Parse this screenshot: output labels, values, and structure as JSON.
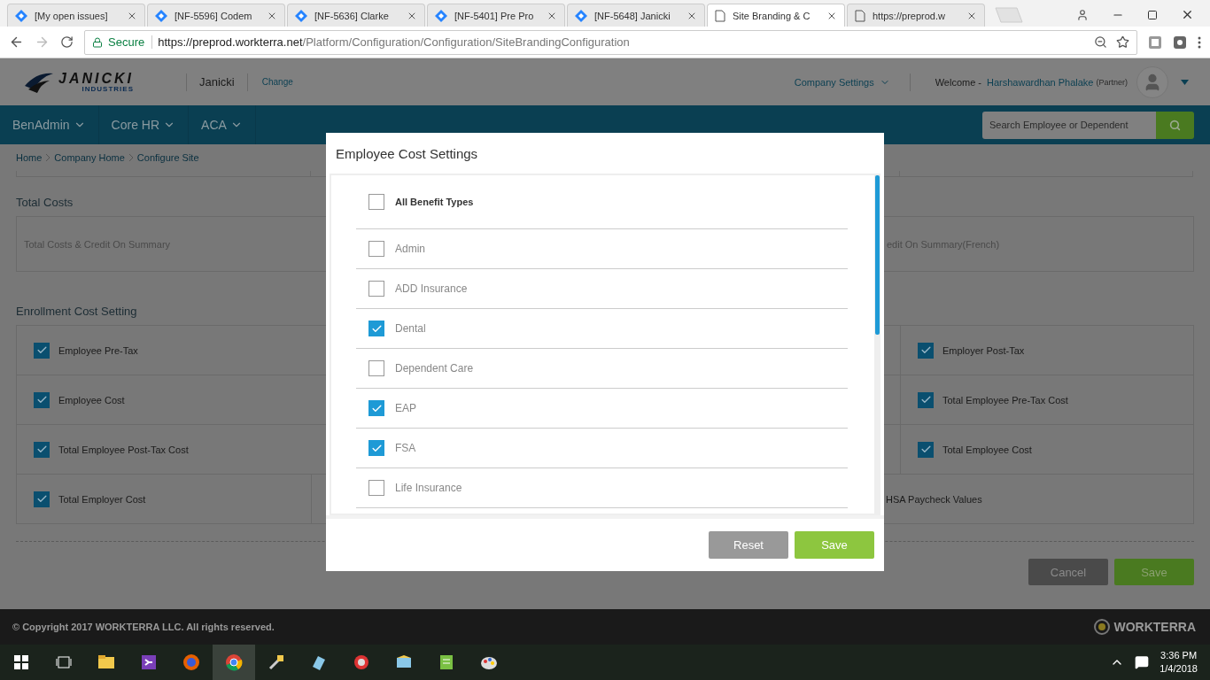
{
  "browser": {
    "tabs": [
      {
        "title": "[My open issues]",
        "kind": "jira",
        "selected": false
      },
      {
        "title": "[NF-5596] Codem",
        "kind": "jira",
        "selected": false
      },
      {
        "title": "[NF-5636] Clarke",
        "kind": "jira",
        "selected": false
      },
      {
        "title": "[NF-5401] Pre Pro",
        "kind": "jira",
        "selected": false
      },
      {
        "title": "[NF-5648] Janicki",
        "kind": "jira",
        "selected": false
      },
      {
        "title": "Site Branding & C",
        "kind": "page",
        "selected": true
      },
      {
        "title": "https://preprod.w",
        "kind": "page",
        "selected": false
      }
    ],
    "address": {
      "secure": "Secure",
      "host": "https://preprod.workterra.net",
      "path": "/Platform/Configuration/Configuration/SiteBrandingConfiguration"
    }
  },
  "header": {
    "logo": {
      "name": "JANICKI",
      "sub": "INDUSTRIES"
    },
    "company": "Janicki",
    "change": "Change",
    "company_settings": "Company Settings",
    "welcome": "Welcome -",
    "user": "Harshawardhan Phalake",
    "role": "(Partner)"
  },
  "nav": {
    "items": [
      "BenAdmin",
      "Core HR",
      "ACA"
    ],
    "search": {
      "placeholder": "Search Employee or Dependent"
    }
  },
  "breadcrumb": [
    "Home",
    "Company Home",
    "Configure Site"
  ],
  "total_costs": {
    "title": "Total Costs",
    "cells": [
      "Total Costs & Credit On Summary",
      "edit On Summary(French)"
    ]
  },
  "enrollment": {
    "title": "Enrollment Cost Setting",
    "rows": [
      {
        "cells": [
          {
            "kind": "checkbox",
            "label": "Employee Pre-Tax",
            "checked": true
          },
          {
            "kind": "checkbox",
            "label": "Employer Post-Tax",
            "checked": true
          }
        ]
      },
      {
        "cells": [
          {
            "kind": "checkbox",
            "label": "Employee Cost",
            "checked": true
          },
          {
            "kind": "checkbox",
            "label": "Total Employee Pre-Tax Cost",
            "checked": true
          }
        ]
      },
      {
        "cells": [
          {
            "kind": "checkbox",
            "label": "Total Employee Post-Tax Cost",
            "checked": true
          },
          {
            "kind": "checkbox",
            "label": "Total Employee Cost",
            "checked": true
          }
        ]
      },
      {
        "cells": [
          {
            "kind": "checkbox",
            "label": "Total Employer Cost",
            "checked": true
          },
          {
            "kind": "text",
            "label": "HSA Paycheck Values"
          }
        ]
      }
    ]
  },
  "actions": {
    "cancel": "Cancel",
    "save": "Save"
  },
  "modal": {
    "title": "Employee Cost Settings",
    "all": {
      "label": "All Benefit Types",
      "checked": false
    },
    "items": [
      {
        "label": "Admin",
        "checked": false
      },
      {
        "label": "ADD Insurance",
        "checked": false
      },
      {
        "label": "Dental",
        "checked": true
      },
      {
        "label": "Dependent Care",
        "checked": false
      },
      {
        "label": "EAP",
        "checked": true
      },
      {
        "label": "FSA",
        "checked": true
      },
      {
        "label": "Life Insurance",
        "checked": false
      }
    ],
    "reset": "Reset",
    "save": "Save"
  },
  "footer": {
    "copyright": "© Copyright 2017 WORKTERRA LLC. All rights reserved.",
    "brand": "WORKTERRA"
  },
  "taskbar": {
    "time": "3:36 PM",
    "date": "1/4/2018"
  }
}
